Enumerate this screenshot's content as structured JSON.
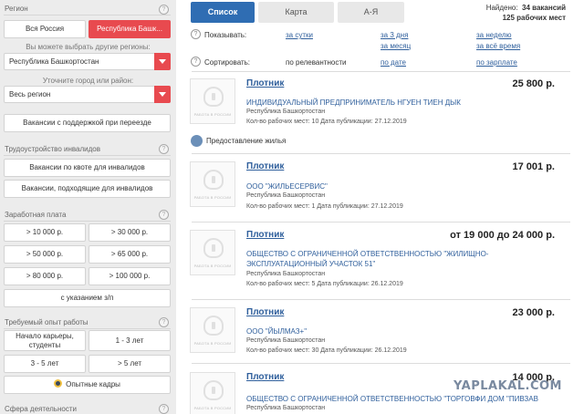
{
  "sidebar": {
    "region": {
      "title": "Регион",
      "btn_all": "Вся Россия",
      "btn_selected": "Республика Башк...",
      "note": "Вы можете выбрать другие регионы:",
      "region_select": "Республика Башкортостан",
      "city_note": "Уточните город или район:",
      "city_select": "Весь регион",
      "relocation_button": "Вакансии с поддержкой при переезде"
    },
    "disabled": {
      "title": "Трудоустройство инвалидов",
      "quota_button": "Вакансии по квоте для инвалидов",
      "suitable_button": "Вакансии, подходящие для инвалидов"
    },
    "salary": {
      "title": "Заработная плата",
      "options": [
        "> 10 000 р.",
        "> 30 000 р.",
        "> 50 000 р.",
        "> 65 000 р.",
        "> 80 000 р.",
        "> 100 000 р."
      ],
      "with_salary": "с указанием з/п"
    },
    "experience": {
      "title": "Требуемый опыт работы",
      "options": [
        "Начало карьеры, студенты",
        "1 - 3 лет",
        "3 - 5 лет",
        "> 5 лет"
      ],
      "experienced": "Опытные кадры"
    },
    "sphere": {
      "title": "Сфера деятельности"
    },
    "help_glyph": "?"
  },
  "tabs": {
    "list": "Список",
    "map": "Карта",
    "az": "А-Я"
  },
  "found": {
    "label": "Найдено:",
    "vacancies": "34 вакансий",
    "workplaces": "125 рабочих мест"
  },
  "filters": {
    "show_label": "Показывать:",
    "day": "за сутки",
    "three_days": "за 3 дня",
    "week": "за неделю",
    "month": "за месяц",
    "all_time": "за всё время",
    "sort_label": "Сортировать:",
    "relevance": "по релевантности",
    "date": "по дате",
    "salary": "по зарплате"
  },
  "logo_text": "РАБОТА В РОССИИ",
  "housing": "Предоставление жилья",
  "vacancies": [
    {
      "title": "Плотник",
      "salary": "25 800 р.",
      "company": "ИНДИВИДУАЛЬНЫЙ ПРЕДПРИНИМАТЕЛЬ НГУЕН ТИЕН ДЫК",
      "region": "Республика Башкортостан",
      "meta": "Кол-во рабочих мест: 10   Дата публикации: 27.12.2019"
    },
    {
      "title": "Плотник",
      "salary": "17 001 р.",
      "company": "ООО \"ЖИЛЬЕСЕРВИС\"",
      "region": "Республика Башкортостан",
      "meta": "Кол-во рабочих мест: 1   Дата публикации: 27.12.2019"
    },
    {
      "title": "Плотник",
      "salary": "от 19 000 до 24 000 р.",
      "company": "ОБЩЕСТВО С ОГРАНИЧЕННОЙ ОТВЕТСТВЕННОСТЬЮ \"ЖИЛИЩНО-ЭКСПЛУАТАЦИОННЫЙ УЧАСТОК 51\"",
      "region": "Республика Башкортостан",
      "meta": "Кол-во рабочих мест: 5   Дата публикации: 26.12.2019"
    },
    {
      "title": "Плотник",
      "salary": "23 000 р.",
      "company": "ООО \"ЙЫЛМАЗ+\"",
      "region": "Республика Башкортостан",
      "meta": "Кол-во рабочих мест: 30   Дата публикации: 26.12.2019"
    },
    {
      "title": "Плотник",
      "salary": "14 000 р.",
      "company": "ОБЩЕСТВО С ОГРАНИЧЕННОЙ ОТВЕТСТВЕННОСТЬЮ \"ТОРГОВФИ ДОМ \"ПИВЗАВОД\"",
      "region": "Республика Башкортостан",
      "meta": ""
    }
  ],
  "watermark": "YAPLAKAL.COM",
  "colors": {
    "accent_red": "#e84a4f",
    "tab_blue": "#2f6db3",
    "link_blue": "#2f5f9c"
  }
}
